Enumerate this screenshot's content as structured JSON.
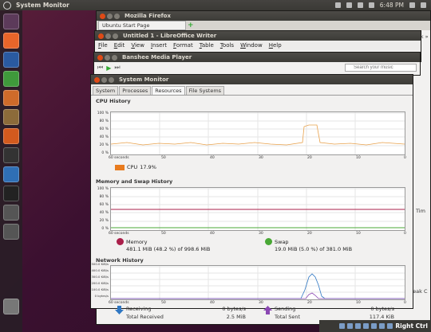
{
  "topbar": {
    "title": "System Monitor",
    "time": "6:48 PM"
  },
  "firefox": {
    "title": "Mozilla Firefox",
    "tab": "Ubuntu Start Page",
    "side_text": "eedback »"
  },
  "writer": {
    "title": "Untitled 1 - LibreOffice Writer",
    "menus": [
      "File",
      "Edit",
      "View",
      "Insert",
      "Format",
      "Table",
      "Tools",
      "Window",
      "Help"
    ]
  },
  "banshee": {
    "title": "Banshee Media Player",
    "search_placeholder": "Search your music"
  },
  "sysmon": {
    "title": "System Monitor",
    "tabs": [
      "System",
      "Processes",
      "Resources",
      "File Systems"
    ],
    "active_tab": "Resources",
    "cpu": {
      "title": "CPU History",
      "label": "CPU",
      "value": "17.9%",
      "y_ticks": [
        "100 %",
        "80 %",
        "60 %",
        "40 %",
        "20 %",
        "0 %"
      ],
      "color": "#e87b1e"
    },
    "mem": {
      "title": "Memory and Swap History",
      "y_ticks": [
        "100 %",
        "80 %",
        "60 %",
        "40 %",
        "20 %",
        "0 %"
      ],
      "memory_label": "Memory",
      "memory_value": "481.1 MiB (48.2 %) of 998.6 MiB",
      "swap_label": "Swap",
      "swap_value": "19.0 MiB (5.0 %) of 381.0 MiB",
      "mem_color": "#aa1f4a",
      "swap_color": "#49a835"
    },
    "net": {
      "title": "Network History",
      "y_ticks": [
        "500.0 KiB/s",
        "400.0 KiB/s",
        "300.0 KiB/s",
        "200.0 KiB/s",
        "100.0 KiB/s",
        "0 bytes/s"
      ],
      "receiving_label": "Receiving",
      "receiving_value": "0 bytes/s",
      "total_received_label": "Total Received",
      "total_received_value": "2.5 MiB",
      "sending_label": "Sending",
      "sending_value": "0 bytes/s",
      "total_sent_label": "Total Sent",
      "total_sent_value": "117.4 KiB",
      "recv_color": "#2f77c3",
      "send_color": "#8b48b3"
    },
    "x_ticks": [
      "60 seconds",
      "50",
      "40",
      "30",
      "20",
      "10",
      "0"
    ]
  },
  "bottom": {
    "right_ctrl": "Right Ctrl"
  },
  "side_labels": {
    "tim": "Tim",
    "speaker": "peak C"
  }
}
